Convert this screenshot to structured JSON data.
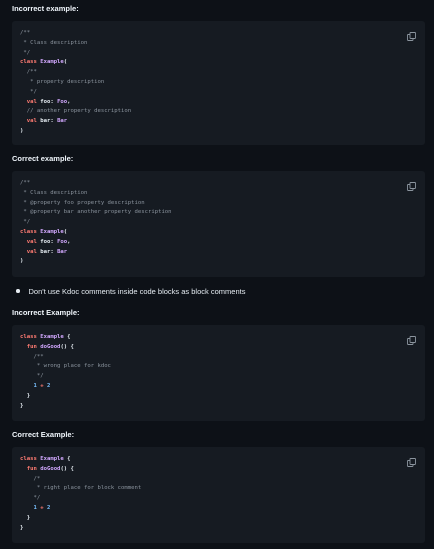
{
  "sections": [
    {
      "heading": "Incorrect example:",
      "code": [
        [
          [
            "comment",
            "/**"
          ]
        ],
        [
          [
            "comment",
            " * Class description"
          ]
        ],
        [
          [
            "comment",
            " */"
          ]
        ],
        [
          [
            "kw",
            "class "
          ],
          [
            "cls",
            "Example"
          ],
          [
            "pl",
            "("
          ]
        ],
        [
          [
            "comment",
            "  /**"
          ]
        ],
        [
          [
            "comment",
            "   * property description"
          ]
        ],
        [
          [
            "comment",
            "   */"
          ]
        ],
        [
          [
            "kw",
            "  val "
          ],
          [
            "pl",
            "foo: "
          ],
          [
            "type",
            "Foo"
          ],
          [
            "pl",
            ","
          ]
        ],
        [
          [
            "comment",
            "  // another property description"
          ]
        ],
        [
          [
            "kw",
            "  val "
          ],
          [
            "pl",
            "bar: "
          ],
          [
            "type",
            "Bar"
          ]
        ],
        [
          [
            "pl",
            ")"
          ]
        ]
      ]
    },
    {
      "heading": "Correct example:",
      "code": [
        [
          [
            "comment",
            "/**"
          ]
        ],
        [
          [
            "comment",
            " * Class description"
          ]
        ],
        [
          [
            "comment",
            " * @property foo property description"
          ]
        ],
        [
          [
            "comment",
            " * @property bar another property description"
          ]
        ],
        [
          [
            "comment",
            " */"
          ]
        ],
        [
          [
            "kw",
            "class "
          ],
          [
            "cls",
            "Example"
          ],
          [
            "pl",
            "("
          ]
        ],
        [
          [
            "kw",
            "  val "
          ],
          [
            "pl",
            "foo: "
          ],
          [
            "type",
            "Foo"
          ],
          [
            "pl",
            ","
          ]
        ],
        [
          [
            "kw",
            "  val "
          ],
          [
            "pl",
            "bar: "
          ],
          [
            "type",
            "Bar"
          ]
        ],
        [
          [
            "pl",
            ")"
          ]
        ]
      ]
    },
    {
      "heading": "Incorrect Example:",
      "code": [
        [
          [
            "kw",
            "class "
          ],
          [
            "cls",
            "Example "
          ],
          [
            "pl",
            "{"
          ]
        ],
        [
          [
            "kw",
            "  fun "
          ],
          [
            "fn",
            "doGood"
          ],
          [
            "pl",
            "() {"
          ]
        ],
        [
          [
            "comment",
            "    /**"
          ]
        ],
        [
          [
            "comment",
            "     * wrong place for kdoc"
          ]
        ],
        [
          [
            "comment",
            "     */"
          ]
        ],
        [
          [
            "num",
            "    1 "
          ],
          [
            "op",
            "+ "
          ],
          [
            "num",
            "2"
          ]
        ],
        [
          [
            "pl",
            "  }"
          ]
        ],
        [
          [
            "pl",
            "}"
          ]
        ]
      ]
    },
    {
      "heading": "Correct Example:",
      "code": [
        [
          [
            "kw",
            "class "
          ],
          [
            "cls",
            "Example "
          ],
          [
            "pl",
            "{"
          ]
        ],
        [
          [
            "kw",
            "  fun "
          ],
          [
            "fn",
            "doGood"
          ],
          [
            "pl",
            "() {"
          ]
        ],
        [
          [
            "comment",
            "    /*"
          ]
        ],
        [
          [
            "comment",
            "     * right place for block comment"
          ]
        ],
        [
          [
            "comment",
            "    */"
          ]
        ],
        [
          [
            "num",
            "    1 "
          ],
          [
            "op",
            "+ "
          ],
          [
            "num",
            "2"
          ]
        ],
        [
          [
            "pl",
            "  }"
          ]
        ],
        [
          [
            "pl",
            "}"
          ]
        ]
      ]
    }
  ],
  "bullet": {
    "text": "Don't use Kdoc comments inside code blocks as block comments"
  },
  "icons": {
    "copy": "copy-icon"
  },
  "colors": {
    "background": "#0d1117",
    "code_background": "#161b22",
    "comment": "#8b949e",
    "keyword": "#ff7b72",
    "class_name": "#d2a8ff",
    "number": "#79c0ff"
  }
}
